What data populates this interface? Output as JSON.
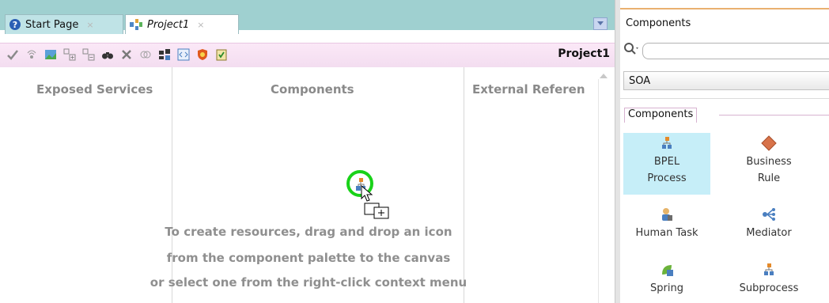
{
  "tabs": [
    {
      "label": "Start Page",
      "icon": "help-circle-icon",
      "close": "×"
    },
    {
      "label": "Project1",
      "icon": "composite-icon",
      "close": "×"
    }
  ],
  "toolbar": {
    "title": "Project1",
    "icons": [
      "validate-icon",
      "wire-icon",
      "image-icon",
      "expand-icon",
      "collapse-icon",
      "find-icon",
      "delete-icon",
      "link-icon",
      "deploy-icon",
      "xml-icon",
      "security-icon",
      "test-icon"
    ]
  },
  "canvas": {
    "columns": [
      "Exposed Services",
      "Components",
      "External Referen"
    ],
    "hint_lines": [
      "To create resources, drag and drop an icon",
      "from the component palette to the canvas",
      "or select one from the right-click context menu"
    ]
  },
  "palette": {
    "title": "Components",
    "search_placeholder": "",
    "category": "SOA",
    "section": "Components",
    "items": [
      {
        "label": "BPEL\nProcess",
        "line1": "BPEL",
        "line2": "Process",
        "icon": "bpel-process-icon",
        "selected": true
      },
      {
        "label": "Business\nRule",
        "line1": "Business",
        "line2": "Rule",
        "icon": "business-rule-icon",
        "selected": false
      },
      {
        "label": "Human Task",
        "line1": "Human Task",
        "line2": "",
        "icon": "human-task-icon",
        "selected": false
      },
      {
        "label": "Mediator",
        "line1": "Mediator",
        "line2": "",
        "icon": "mediator-icon",
        "selected": false
      },
      {
        "label": "Spring",
        "line1": "Spring",
        "line2": "",
        "icon": "spring-icon",
        "selected": false
      },
      {
        "label": "Subprocess",
        "line1": "Subprocess",
        "line2": "",
        "icon": "subprocess-icon",
        "selected": false
      }
    ]
  },
  "colors": {
    "tab_strip": "#9fd0d0",
    "toolbar_pink": "#f6e0f3",
    "drag_ring": "#19d219",
    "selected_item": "#c6eef8"
  }
}
